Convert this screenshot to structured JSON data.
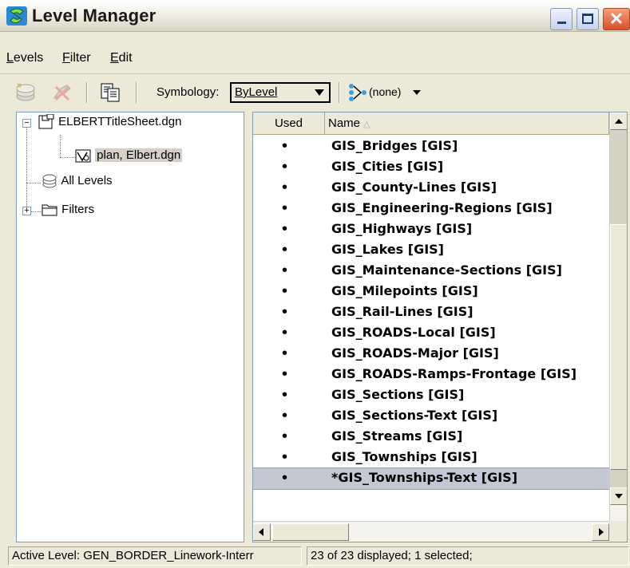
{
  "window": {
    "title": "Level Manager",
    "icon": "microstation-icon"
  },
  "menu": {
    "items": [
      {
        "first": "L",
        "rest": "evels"
      },
      {
        "first": "F",
        "rest": "ilter"
      },
      {
        "first": "E",
        "rest": "dit"
      }
    ]
  },
  "toolbar": {
    "symbology_label": "Symbology:",
    "symbology_value": "ByLevel",
    "filter_value": "(none)"
  },
  "tree": {
    "root": "ELBERTTitleSheet.dgn",
    "child": "plan, Elbert.dgn",
    "all_levels": "All Levels",
    "filters": "Filters"
  },
  "list": {
    "headers": {
      "used": "Used",
      "name": "Name"
    },
    "rows": [
      {
        "used": "•",
        "name": "GIS_Bridges [GIS]"
      },
      {
        "used": "•",
        "name": "GIS_Cities [GIS]"
      },
      {
        "used": "•",
        "name": "GIS_County-Lines [GIS]"
      },
      {
        "used": "•",
        "name": "GIS_Engineering-Regions [GIS]"
      },
      {
        "used": "•",
        "name": "GIS_Highways [GIS]"
      },
      {
        "used": "•",
        "name": "GIS_Lakes [GIS]"
      },
      {
        "used": "•",
        "name": "GIS_Maintenance-Sections [GIS]"
      },
      {
        "used": "•",
        "name": "GIS_Milepoints [GIS]"
      },
      {
        "used": "•",
        "name": "GIS_Rail-Lines [GIS]"
      },
      {
        "used": "•",
        "name": "GIS_ROADS-Local [GIS]"
      },
      {
        "used": "•",
        "name": "GIS_ROADS-Major [GIS]"
      },
      {
        "used": "•",
        "name": "GIS_ROADS-Ramps-Frontage [GIS]"
      },
      {
        "used": "•",
        "name": "GIS_Sections [GIS]"
      },
      {
        "used": "•",
        "name": "GIS_Sections-Text [GIS]"
      },
      {
        "used": "•",
        "name": "GIS_Streams [GIS]"
      },
      {
        "used": "•",
        "name": "GIS_Townships [GIS]"
      },
      {
        "used": "•",
        "name": "*GIS_Townships-Text [GIS]"
      }
    ],
    "selected_row": "*GIS_Townships-Text [GIS]"
  },
  "status": {
    "active_level": "Active Level: GEN_BORDER_Linework-Interr",
    "summary": "23 of 23 displayed; 1 selected;"
  },
  "colors": {
    "titlebar": "#f4f2e8",
    "window_bg": "#ece9d8",
    "selected_row": "#c4c8d4",
    "close_button": "#d9502a"
  }
}
